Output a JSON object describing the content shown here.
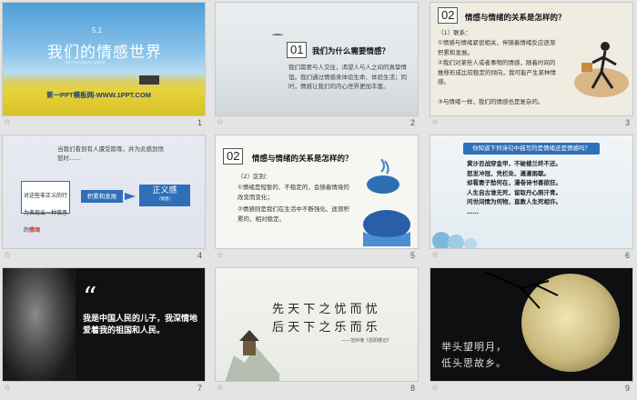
{
  "slides": [
    {
      "number": "1",
      "title_num": "5.1",
      "title": "我们的情感世界",
      "subtitle": "Our emotions  world",
      "footer": "第一PPT模板网-WWW.1PPT.COM"
    },
    {
      "number": "2",
      "badge": "01",
      "heading": "我们为什么需要情感？",
      "body": "我们需要与人交往，渴望人与人之间的真挚情谊。我们通过情感来体验生命、体验生活；同时，情感让我们的内心世界更加丰富。"
    },
    {
      "number": "3",
      "badge": "02",
      "heading": "情感与情绪的关系是怎样的？",
      "items": [
        "（1）联系：",
        "①情感与情绪紧密相关，伴随着情绪反应逐渐积累和发展。",
        "②我们对某些人或者事物的情感，随着时间的推移形成比较稳定的倾向，我可能产生某种情感。",
        "③与情绪一样，我们的情感也是复杂的。"
      ]
    },
    {
      "number": "4",
      "quote": "当我们看到有人遭受欺辱，并为此感到愤怒时……",
      "box_text": "对这些非正义的行为表现出一种憎恶的",
      "box_highlight": "情绪",
      "middle_label": "积累和发展",
      "result_label": "正义感",
      "result_small": "（情感）"
    },
    {
      "number": "5",
      "badge": "02",
      "heading": "情感与情绪的关系是怎样的？",
      "items": [
        "（2）区别：",
        "①情绪是短暂的、不稳定的，会随着情境的改变而变化；",
        "②情感则是我们在生活中不断强化、逐渐积累的，相对稳定。"
      ]
    },
    {
      "number": "6",
      "question": "你知道下列诗句中描写的是情绪还是情感吗？",
      "poems": [
        "黄沙百战穿金甲，不破楼兰终不还。",
        "怒发冲冠，凭栏处、潇潇雨歇。",
        "却看妻子愁何在，漫卷诗书喜欲狂。",
        "人生自古谁无死，留取丹心照汗青。",
        "问世间情为何物，直教人生死相许。",
        "……"
      ]
    },
    {
      "number": "7",
      "quote_mark": "“",
      "quote_text": "我是中国人民的儿子，我深情地爱着我的祖国和人民。"
    },
    {
      "number": "8",
      "line1": "先 天 下 之 忧 而 忧",
      "line2": "后 天 下 之 乐 而 乐",
      "attribution": "——范仲淹《岳阳楼记》"
    },
    {
      "number": "9",
      "line1": "举头望明月，",
      "line2": "低头思故乡。"
    }
  ],
  "star_icon": "☆",
  "colors": {
    "accent_blue": "#2f6fb8",
    "moon": "#f0e6b4",
    "dark_bg": "#0f0f12"
  }
}
